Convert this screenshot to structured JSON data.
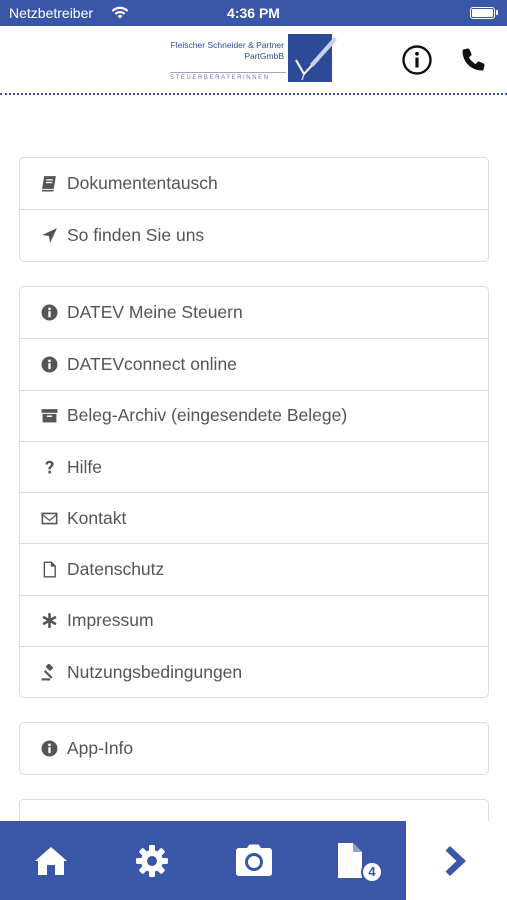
{
  "status_bar": {
    "carrier": "Netzbetreiber",
    "time": "4:36 PM"
  },
  "header": {
    "logo_line1": "Fleischer Schneider & Partner",
    "logo_line2": "PartGmbB",
    "logo_tagline": "STEUERBERATERINNEN",
    "info_icon": "info-circle-icon",
    "phone_icon": "phone-icon"
  },
  "groups": [
    {
      "items": [
        {
          "label": "Dokumententausch",
          "icon": "book-icon"
        },
        {
          "label": "So finden Sie uns",
          "icon": "location-arrow-icon"
        }
      ]
    },
    {
      "items": [
        {
          "label": "DATEV Meine Steuern",
          "icon": "info-circle-icon"
        },
        {
          "label": "DATEVconnect online",
          "icon": "info-circle-icon"
        },
        {
          "label": "Beleg-Archiv (eingesendete Belege)",
          "icon": "archive-icon"
        },
        {
          "label": "Hilfe",
          "icon": "question-icon"
        },
        {
          "label": "Kontakt",
          "icon": "envelope-icon"
        },
        {
          "label": "Datenschutz",
          "icon": "document-icon"
        },
        {
          "label": "Impressum",
          "icon": "asterisk-icon"
        },
        {
          "label": "Nutzungsbedingungen",
          "icon": "gavel-icon"
        }
      ]
    },
    {
      "items": [
        {
          "label": "App-Info",
          "icon": "info-circle-icon"
        }
      ]
    }
  ],
  "tab_bar": {
    "tabs": [
      {
        "icon": "home-icon"
      },
      {
        "icon": "settings-icon"
      },
      {
        "icon": "camera-icon"
      },
      {
        "icon": "documents-icon",
        "badge": "4"
      },
      {
        "icon": "chevron-right-icon"
      }
    ],
    "accent_color": "#3a56a7"
  }
}
